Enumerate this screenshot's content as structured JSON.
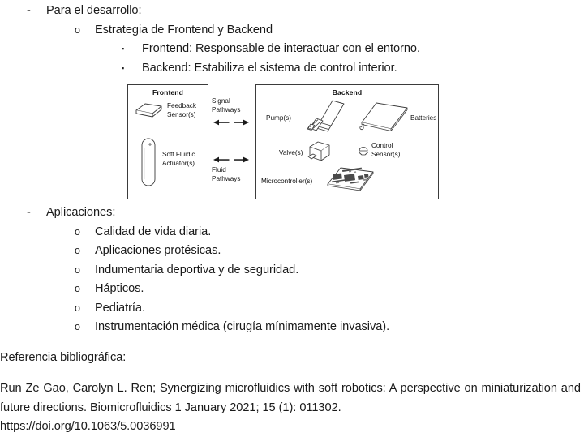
{
  "document": {
    "sections": [
      {
        "id": "desarrollo",
        "level": 1,
        "marker": "-",
        "text": "Para el desarrollo:"
      },
      {
        "id": "estrategia",
        "level": 2,
        "marker": "o",
        "text": "Estrategia de Frontend y Backend"
      },
      {
        "id": "frontend-desc",
        "level": 3,
        "marker": "▪",
        "text": "Frontend: Responsable de interactuar con el entorno."
      },
      {
        "id": "backend-desc",
        "level": 3,
        "marker": "▪",
        "text": "Backend: Estabiliza el sistema de control interior."
      }
    ],
    "applications_heading": {
      "marker": "-",
      "text": "Aplicaciones:"
    },
    "applications": [
      {
        "marker": "o",
        "text": "Calidad de vida diaria."
      },
      {
        "marker": "o",
        "text": "Aplicaciones protésicas."
      },
      {
        "marker": "o",
        "text": "Indumentaria deportiva y de seguridad."
      },
      {
        "marker": "o",
        "text": "Hápticos."
      },
      {
        "marker": "o",
        "text": "Pediatría."
      },
      {
        "marker": "o",
        "text": "Instrumentación médica (cirugía mínimamente invasiva)."
      }
    ],
    "reference": {
      "heading": "Referencia bibliográfica:",
      "citation": "Run Ze Gao, Carolyn L. Ren; Synergizing microfluidics with soft robotics: A perspective on miniaturization and future directions. Biomicrofluidics 1 January 2021; 15 (1): 011302.",
      "doi": "https://doi.org/10.1063/5.0036991"
    }
  },
  "figure": {
    "frontend": {
      "title": "Frontend",
      "items": [
        {
          "icon": "feedback-sensor-icon",
          "label_line1": "Feedback",
          "label_line2": "Sensor(s)"
        },
        {
          "icon": "soft-fluidic-actuator-icon",
          "label_line1": "Soft Fluidic",
          "label_line2": "Actuator(s)"
        }
      ]
    },
    "middle": {
      "signal": {
        "label_line1": "Signal",
        "label_line2": "Pathways"
      },
      "fluid": {
        "label_line1": "Fluid",
        "label_line2": "Pathways"
      }
    },
    "backend": {
      "title": "Backend",
      "items": [
        {
          "icon": "pump-icon",
          "label": "Pump(s)"
        },
        {
          "icon": "battery-icon",
          "label": "Batteries"
        },
        {
          "icon": "valve-icon",
          "label": "Valve(s)"
        },
        {
          "icon": "control-sensor-icon",
          "label_line1": "Control",
          "label_line2": "Sensor(s)"
        },
        {
          "icon": "microcontroller-icon",
          "label": "Microcontroller(s)"
        }
      ]
    },
    "colors": {
      "stroke": "#3b3b3b",
      "fill": "#ffffff",
      "text": "#111111"
    }
  }
}
